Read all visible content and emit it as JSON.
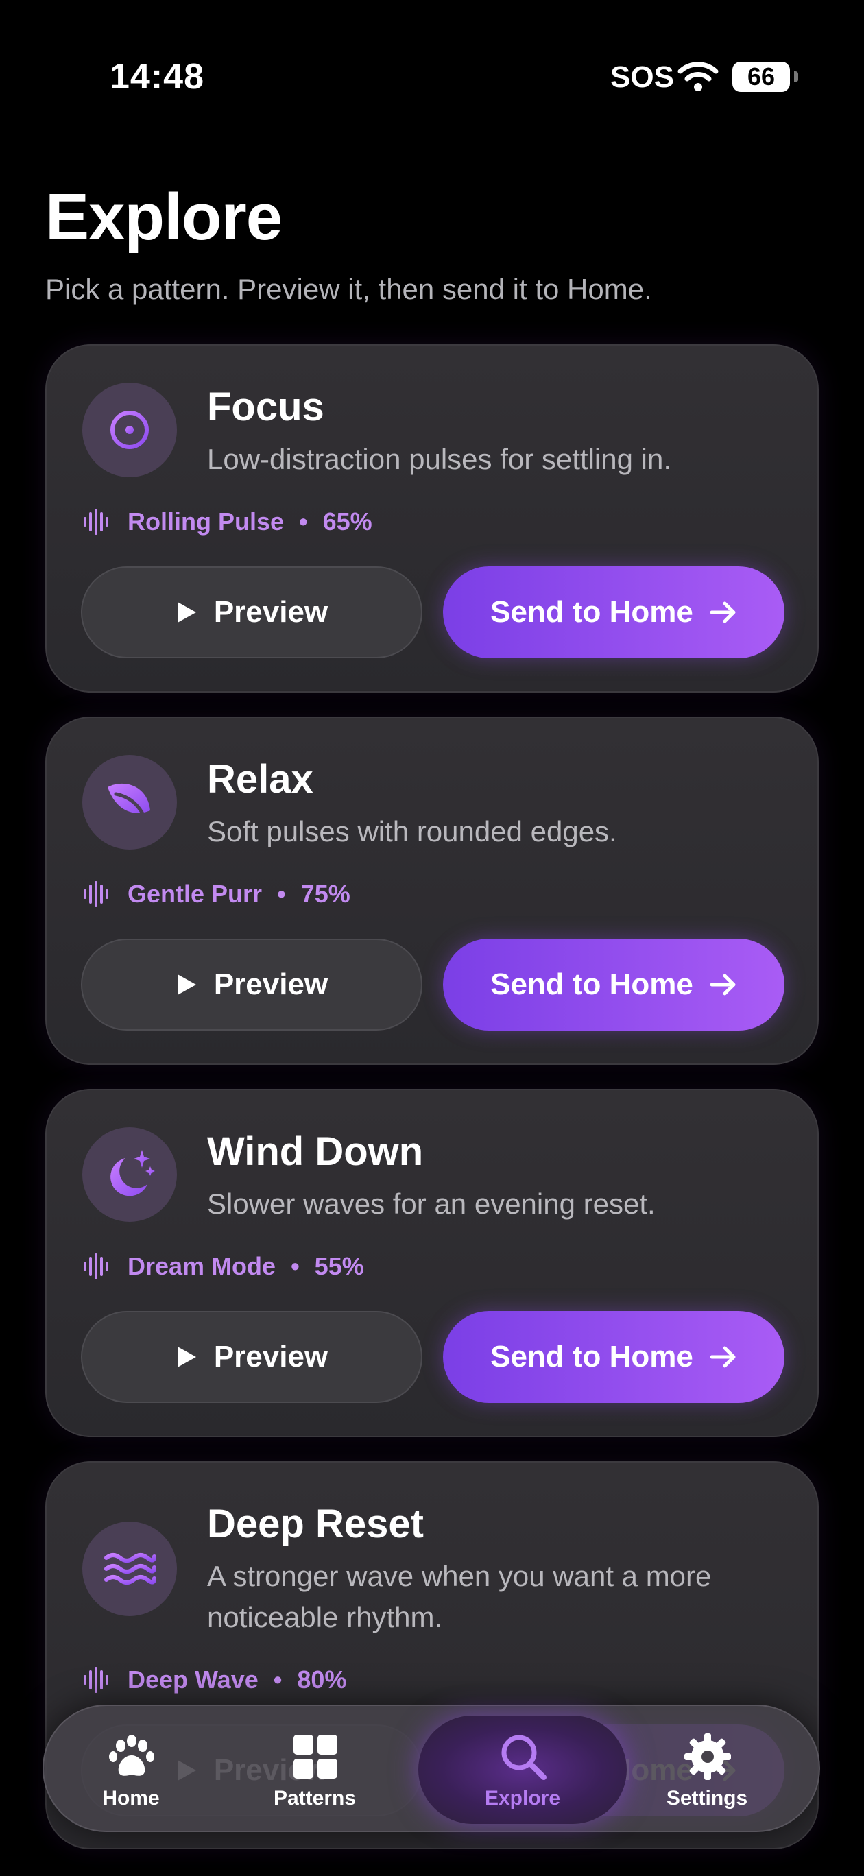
{
  "status": {
    "time": "14:48",
    "sos": "SOS",
    "battery": "66"
  },
  "header": {
    "title": "Explore",
    "subtitle": "Pick a pattern. Preview it, then send it to Home."
  },
  "cards": [
    {
      "title": "Focus",
      "description": "Low-distraction pulses for settling in.",
      "pattern": "Rolling Pulse",
      "intensity": "65%",
      "icon": "crosshair-icon"
    },
    {
      "title": "Relax",
      "description": "Soft pulses with rounded edges.",
      "pattern": "Gentle Purr",
      "intensity": "75%",
      "icon": "leaf-icon"
    },
    {
      "title": "Wind Down",
      "description": "Slower waves for an evening reset.",
      "pattern": "Dream Mode",
      "intensity": "55%",
      "icon": "moon-stars-icon"
    },
    {
      "title": "Deep Reset",
      "description": "A stronger wave when you want a more noticeable rhythm.",
      "pattern": "Deep Wave",
      "intensity": "80%",
      "icon": "waves-icon"
    }
  ],
  "buttons": {
    "preview": "Preview",
    "send": "Send to Home"
  },
  "tabs": [
    {
      "label": "Home",
      "icon": "paw-icon"
    },
    {
      "label": "Patterns",
      "icon": "grid-icon"
    },
    {
      "label": "Explore",
      "icon": "search-icon",
      "active": true
    },
    {
      "label": "Settings",
      "icon": "gear-icon"
    }
  ],
  "colors": {
    "accent": "#a95cf5",
    "accent_text": "#c28af0",
    "background": "#000000",
    "card": "#2e2d31"
  }
}
